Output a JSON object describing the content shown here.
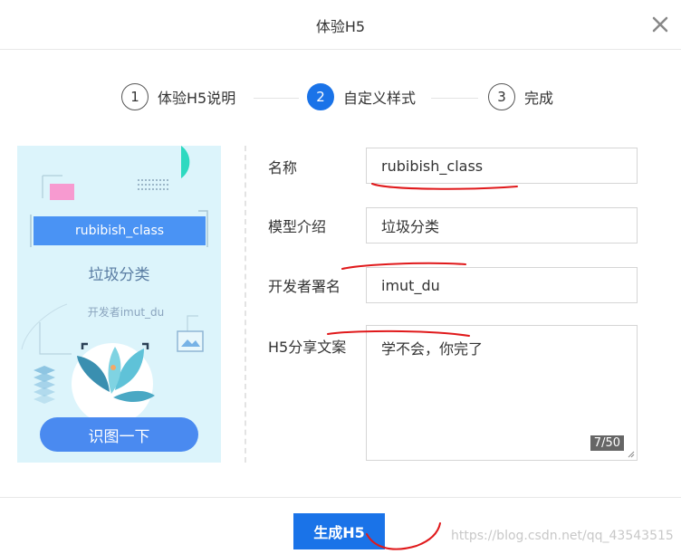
{
  "dialog": {
    "title": "体验H5"
  },
  "steps": [
    {
      "num": "1",
      "label": "体验H5说明",
      "active": false
    },
    {
      "num": "2",
      "label": "自定义样式",
      "active": true
    },
    {
      "num": "3",
      "label": "完成",
      "active": false
    }
  ],
  "preview": {
    "name": "rubibish_class",
    "model": "垃圾分类",
    "developer": "开发者imut_du",
    "button": "识图一下"
  },
  "form": {
    "name_label": "名称",
    "name_value": "rubibish_class",
    "model_label": "模型介绍",
    "model_value": "垃圾分类",
    "author_label": "开发者署名",
    "author_value": "imut_du",
    "share_label": "H5分享文案",
    "share_value": "学不会，你完了",
    "share_counter": "7/50"
  },
  "footer": {
    "generate_label": "生成H5"
  },
  "watermark": "https://blog.csdn.net/qq_43543515",
  "colors": {
    "primary": "#1a73e8",
    "preview_bg": "#dcf4fb",
    "annotation": "#e0191b"
  }
}
